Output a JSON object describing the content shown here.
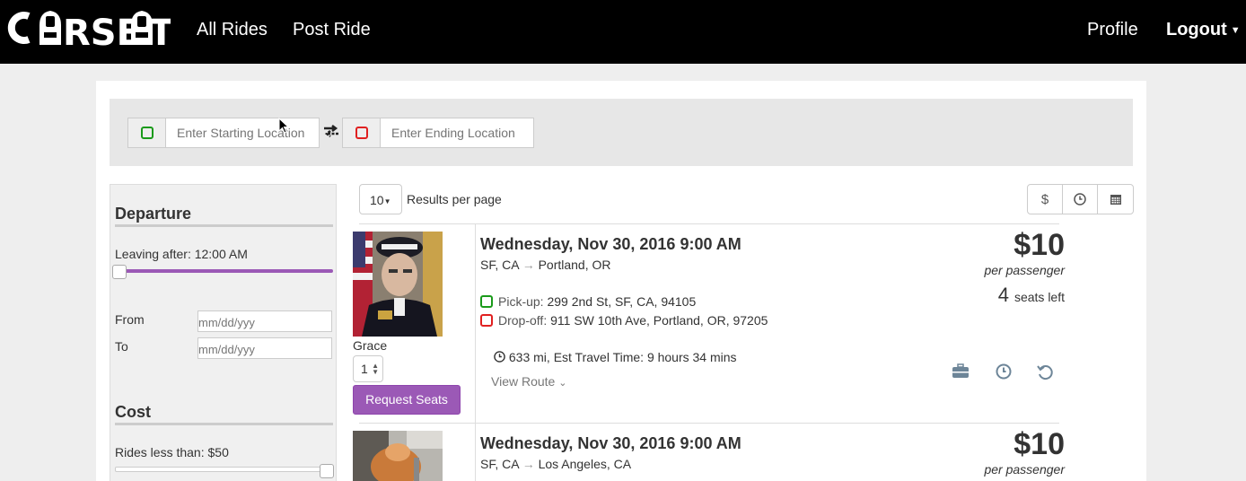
{
  "navbar": {
    "logo": "CARSEAT",
    "links": [
      "All Rides",
      "Post Ride"
    ],
    "right_links": [
      "Profile",
      "Logout"
    ]
  },
  "search": {
    "start_placeholder": "Enter Starting Location",
    "end_placeholder": "Enter Ending Location"
  },
  "sidebar": {
    "departure_heading": "Departure",
    "leaving_after": "Leaving after: 12:00 AM",
    "from_label": "From",
    "to_label": "To",
    "date_placeholder": "mm/dd/yyy",
    "cost_heading": "Cost",
    "rides_less_than": "Rides less than: $50"
  },
  "results": {
    "per_page_value": "10",
    "per_page_label": "Results per page",
    "sort_icons": [
      "dollar-icon",
      "clock-icon",
      "calendar-icon"
    ]
  },
  "rides": [
    {
      "driver": "Grace",
      "seats_selected": "1",
      "request_label": "Request Seats",
      "date": "Wednesday, Nov 30, 2016 9:00 AM",
      "from": "SF, CA",
      "to": "Portland, OR",
      "pickup_label": "Pick-up:",
      "pickup": "299 2nd St, SF, CA, 94105",
      "dropoff_label": "Drop-off:",
      "dropoff": "911 SW 10th Ave, Portland, OR, 97205",
      "travel": "633 mi, Est Travel Time: 9 hours 34 mins",
      "view_route": "View Route",
      "price": "$10",
      "per_passenger": "per passenger",
      "seats_left_num": "4",
      "seats_left_label": "seats left"
    },
    {
      "date": "Wednesday, Nov 30, 2016 9:00 AM",
      "from": "SF, CA",
      "to": "Los Angeles, CA",
      "price": "$10",
      "per_passenger": "per passenger"
    }
  ],
  "colors": {
    "accent": "#9b59b6",
    "pickup": "#1a9a1a",
    "dropoff": "#e02020"
  }
}
